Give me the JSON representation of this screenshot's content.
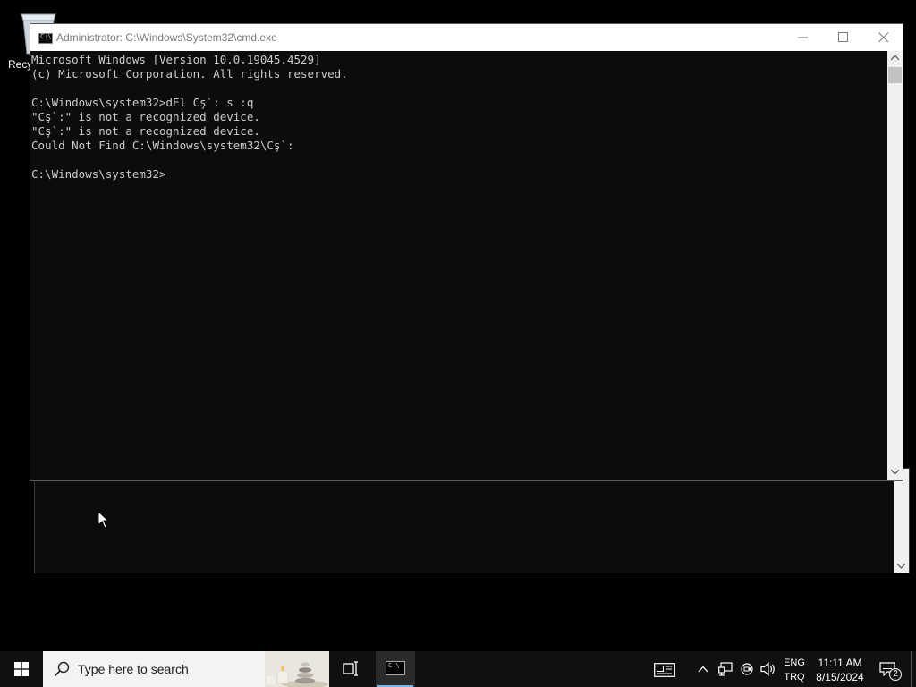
{
  "desktop": {
    "recycle_bin_label": "Recycle Bin"
  },
  "window": {
    "title": "Administrator: C:\\Windows\\System32\\cmd.exe",
    "title_icon_text": "C:\\",
    "console_lines": [
      "Microsoft Windows [Version 10.0.19045.4529]",
      "(c) Microsoft Corporation. All rights reserved.",
      "",
      "C:\\Windows\\system32>dEl Cş`: s :q",
      "\"Cş`:\" is not a recognized device.",
      "\"Cş`:\" is not a recognized device.",
      "Could Not Find C:\\Windows\\system32\\Cş`:",
      "",
      "C:\\Windows\\system32>"
    ]
  },
  "taskbar": {
    "search_placeholder": "Type here to search",
    "cmd_icon_text": "C:\\",
    "language": {
      "top": "ENG",
      "bottom": "TRQ"
    },
    "clock": {
      "time": "11:11 AM",
      "date": "8/15/2024"
    },
    "notification_count": "2"
  },
  "colors": {
    "console_bg": "#0c0c0c",
    "console_text": "#cccccc",
    "taskbar_bg": "#101010",
    "active_underline": "#76b9ed"
  }
}
